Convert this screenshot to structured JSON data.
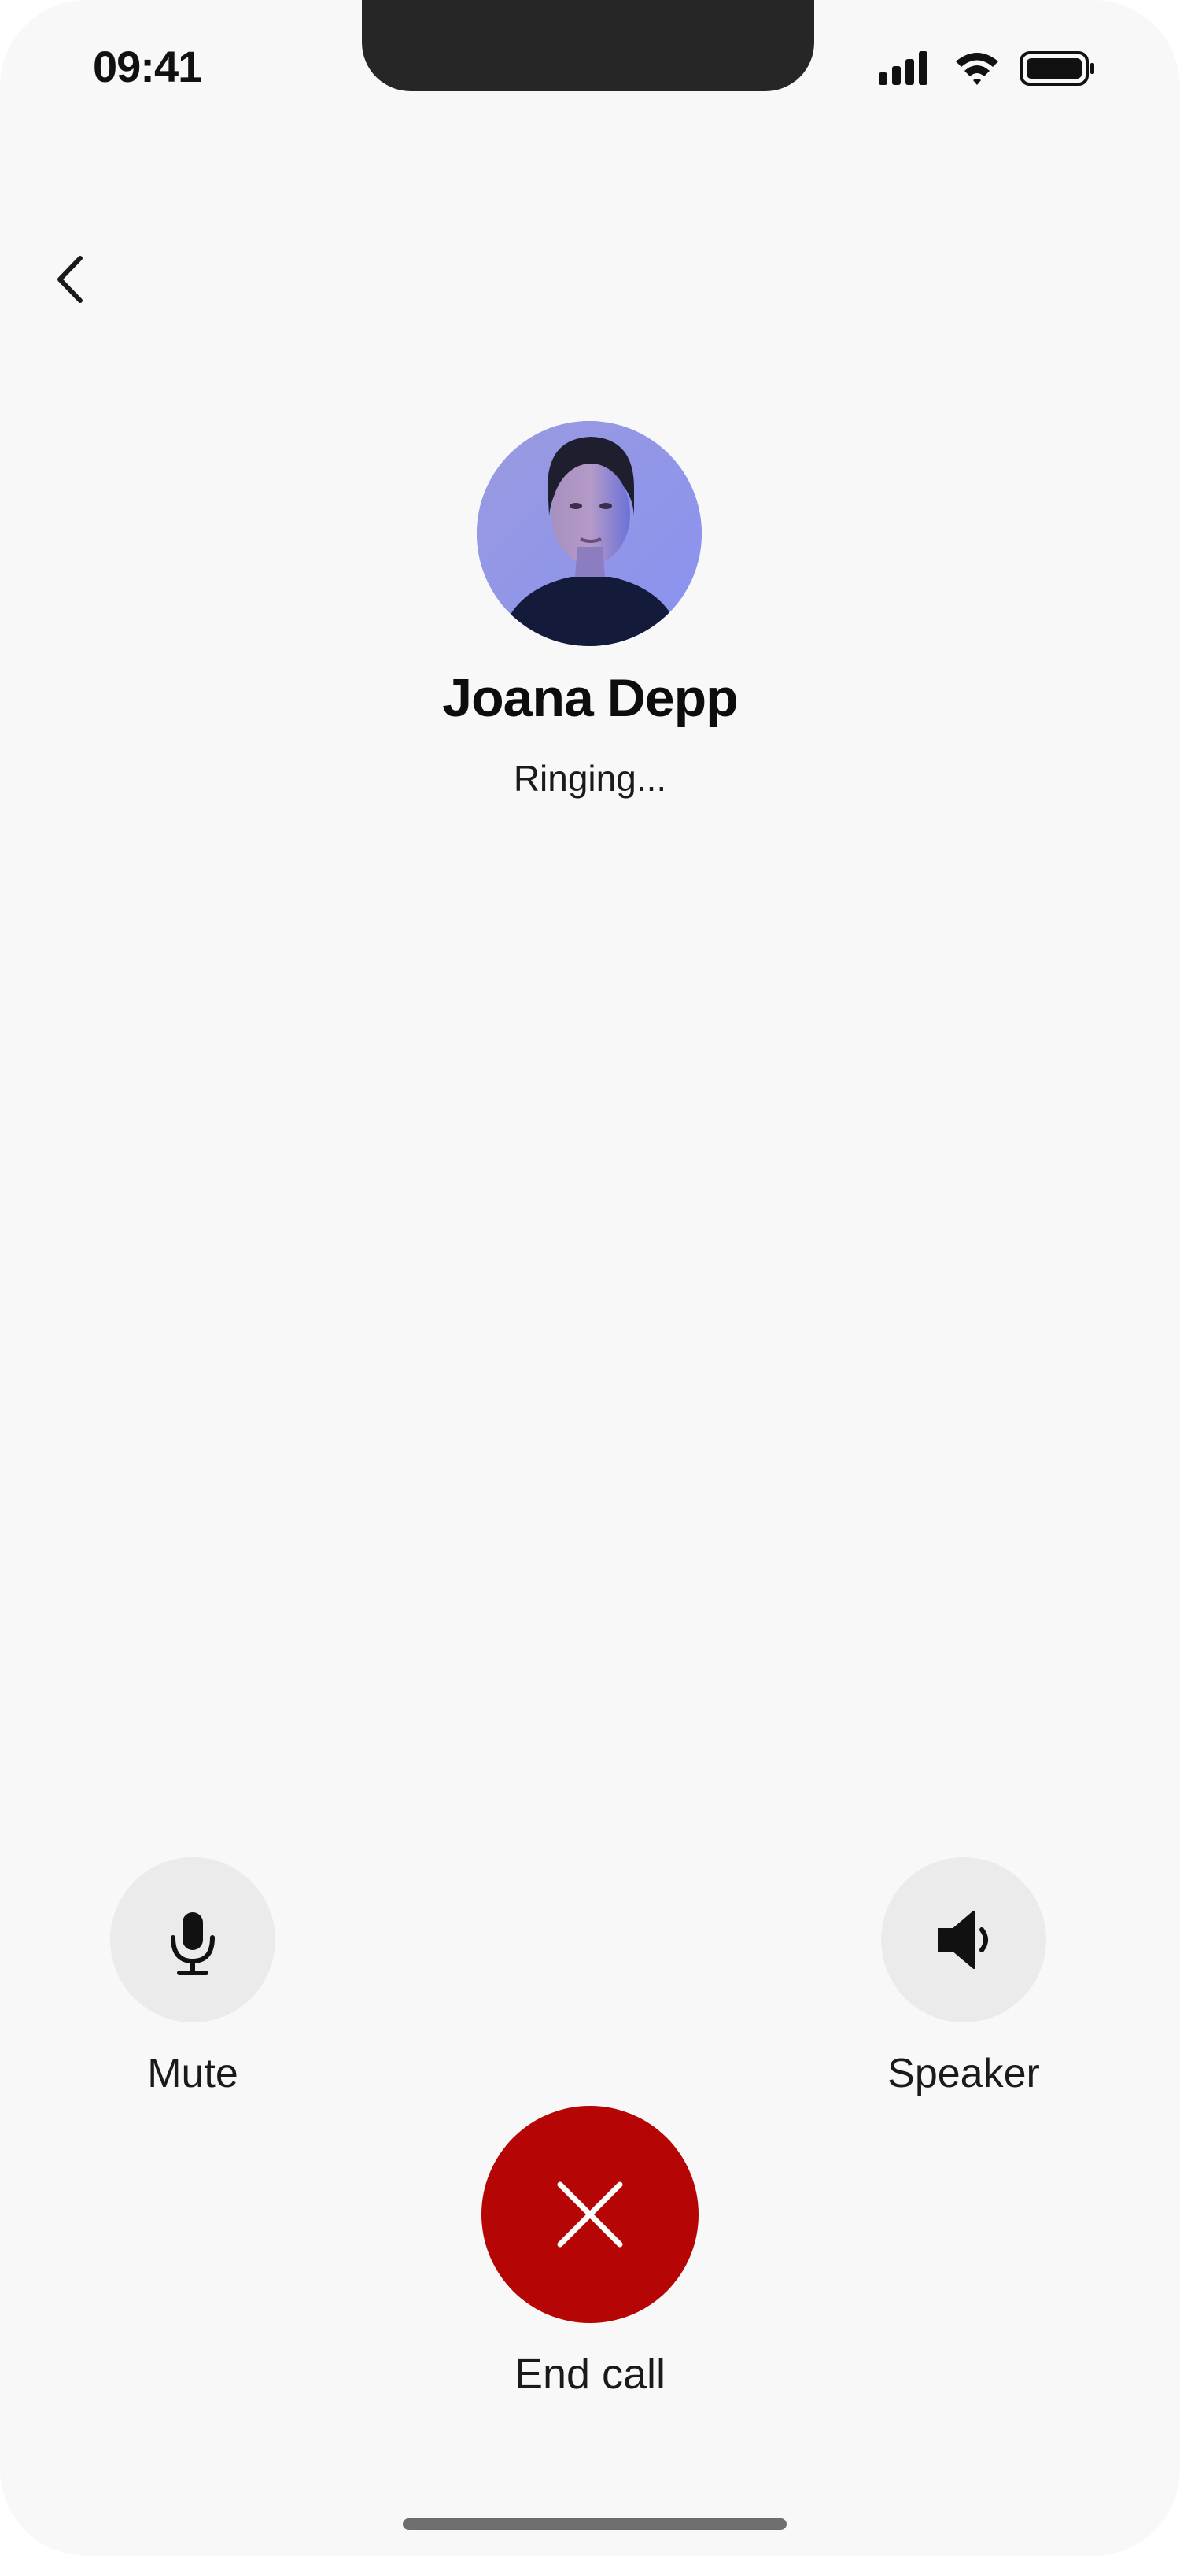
{
  "status_bar": {
    "time": "09:41",
    "icons": [
      "signal-icon",
      "wifi-icon",
      "battery-icon"
    ]
  },
  "navigation": {
    "back_icon": "chevron-left-icon"
  },
  "call": {
    "caller_name": "Joana Depp",
    "status": "Ringing...",
    "avatar_background": "#a4a6ea"
  },
  "controls": {
    "mute": {
      "label": "Mute",
      "icon": "microphone-icon"
    },
    "speaker": {
      "label": "Speaker",
      "icon": "speaker-icon"
    },
    "end_call": {
      "label": "End call",
      "icon": "close-icon",
      "color": "#b50505"
    }
  }
}
